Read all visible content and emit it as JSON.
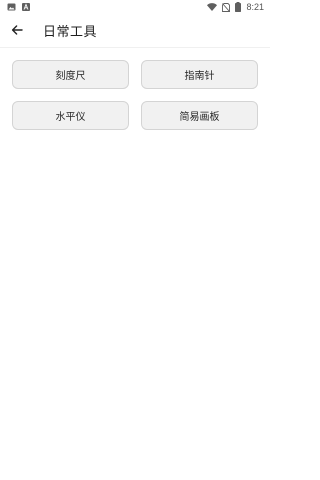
{
  "status_bar": {
    "time": "8:21",
    "left_icons": [
      "image-icon",
      "a-badge-icon"
    ],
    "right_icons": [
      "wifi-icon",
      "no-sim-icon",
      "battery-icon"
    ]
  },
  "app_bar": {
    "back_icon": "arrow-left-icon",
    "title": "日常工具"
  },
  "tools": [
    {
      "label": "刻度尺"
    },
    {
      "label": "指南针"
    },
    {
      "label": "水平仪"
    },
    {
      "label": "简易画板"
    }
  ],
  "colors": {
    "background": "#ffffff",
    "button_bg": "#f1f1f1",
    "button_border": "#d4d4d4",
    "text": "#212121"
  }
}
